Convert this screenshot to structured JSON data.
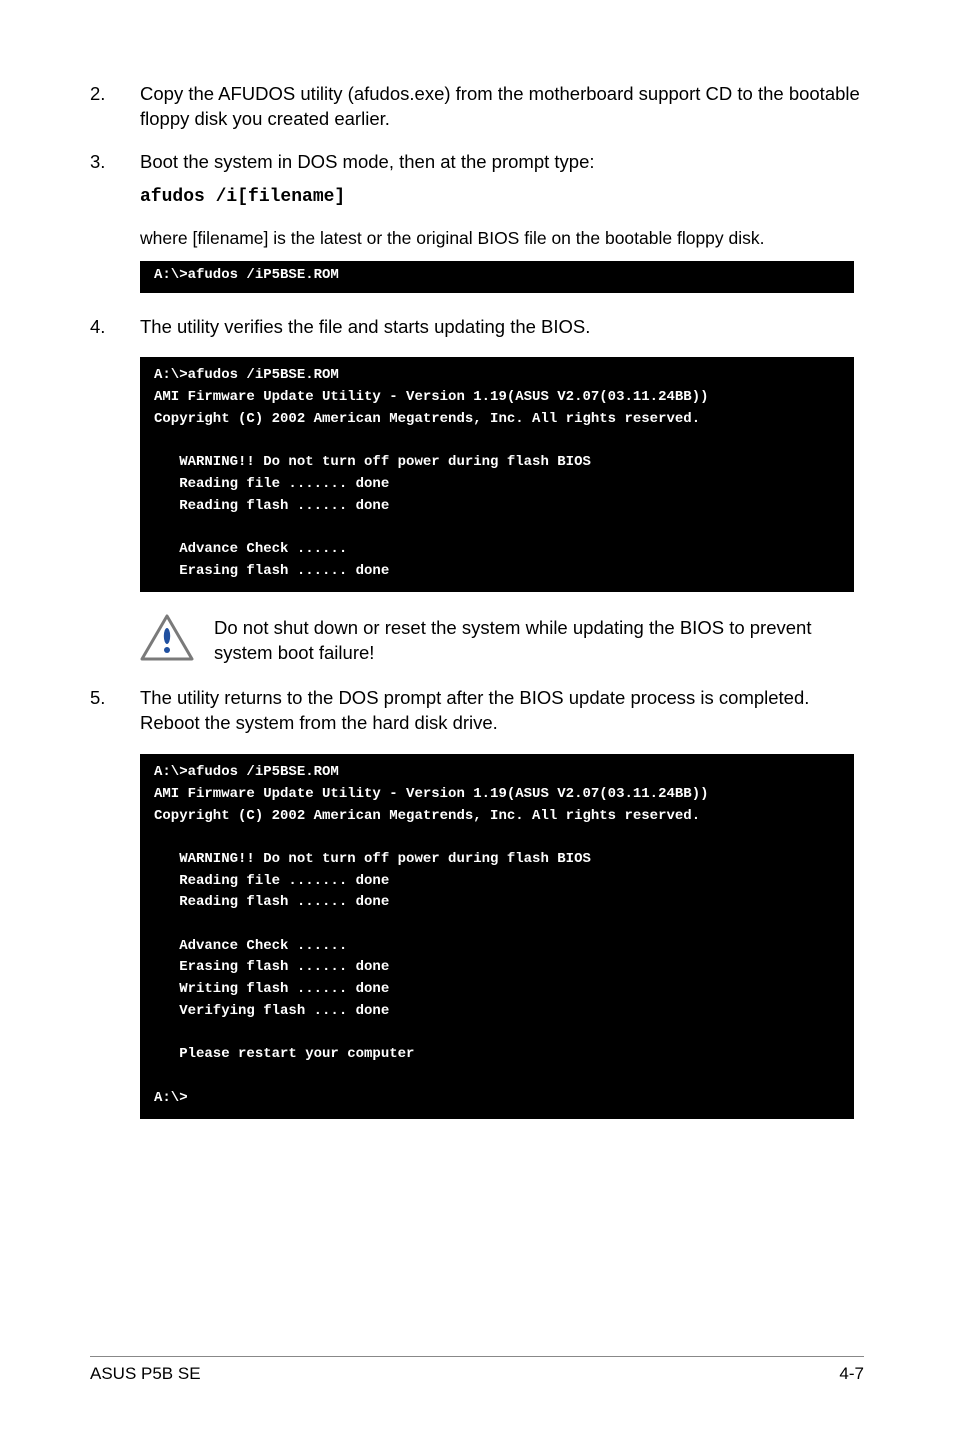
{
  "steps": {
    "s2": {
      "num": "2.",
      "text": "Copy the AFUDOS utility (afudos.exe) from the motherboard support CD to the bootable floppy disk you created earlier."
    },
    "s3": {
      "num": "3.",
      "text": "Boot the system in DOS mode, then at the prompt type:",
      "cmd": "afudos /i[filename]"
    },
    "s4": {
      "num": "4.",
      "text": "The utility verifies the file and starts updating the BIOS."
    },
    "s5": {
      "num": "5.",
      "text": "The utility returns to the DOS prompt after the BIOS update process is completed. Reboot the system from the hard disk drive."
    }
  },
  "interstitial": "where [filename] is the latest or the original BIOS file on the bootable floppy disk.",
  "terminals": {
    "t1": "A:\\>afudos /iP5BSE.ROM",
    "t2": "A:\\>afudos /iP5BSE.ROM\nAMI Firmware Update Utility - Version 1.19(ASUS V2.07(03.11.24BB))\nCopyright (C) 2002 American Megatrends, Inc. All rights reserved.\n\n   WARNING!! Do not turn off power during flash BIOS\n   Reading file ....... done\n   Reading flash ...... done\n\n   Advance Check ......\n   Erasing flash ...... done",
    "t3": "A:\\>afudos /iP5BSE.ROM\nAMI Firmware Update Utility - Version 1.19(ASUS V2.07(03.11.24BB))\nCopyright (C) 2002 American Megatrends, Inc. All rights reserved.\n\n   WARNING!! Do not turn off power during flash BIOS\n   Reading file ....... done\n   Reading flash ...... done\n\n   Advance Check ......\n   Erasing flash ...... done\n   Writing flash ...... done\n   Verifying flash .... done\n\n   Please restart your computer\n\nA:\\>"
  },
  "callout": "Do not shut down or reset the system while updating the BIOS to prevent system boot failure!",
  "footer": {
    "left": "ASUS P5B SE",
    "right": "4-7"
  }
}
